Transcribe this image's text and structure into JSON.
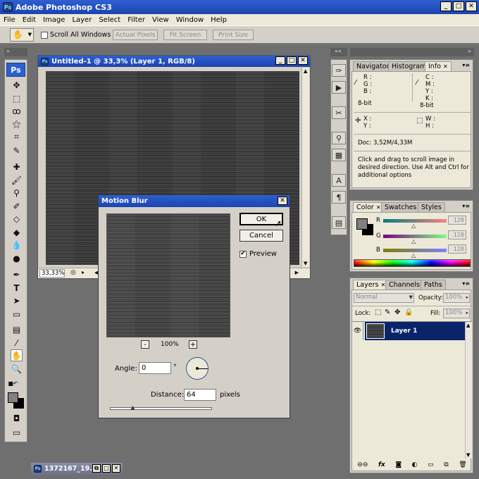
{
  "app": {
    "title": "Adobe Photoshop CS3",
    "icon_text": "Ps"
  },
  "menu": [
    "File",
    "Edit",
    "Image",
    "Layer",
    "Select",
    "Filter",
    "View",
    "Window",
    "Help"
  ],
  "options": {
    "scroll_all_windows_label": "Scroll All Windows",
    "scroll_all_windows_checked": false,
    "actual_pixels": "Actual Pixels",
    "fit_screen": "Fit Screen",
    "print_size": "Print Size"
  },
  "toolbox": {
    "logo": "Ps"
  },
  "document": {
    "title": "Untitled-1 @ 33,3% (Layer 1, RGB/8)",
    "zoom": "33,33%"
  },
  "minimized": {
    "title": "1372167_19..."
  },
  "dialog": {
    "title": "Motion Blur",
    "ok": "OK",
    "cancel": "Cancel",
    "preview_label": "Preview",
    "preview_checked": true,
    "zoom_minus": "-",
    "zoom_plus": "+",
    "zoom_level": "100%",
    "angle_label": "Angle:",
    "angle_value": "0",
    "angle_unit": "°",
    "distance_label": "Distance:",
    "distance_value": "64",
    "distance_unit": "pixels",
    "distance_slider_fraction": 0.23
  },
  "info_panel": {
    "tabs": [
      "Navigator",
      "Histogram",
      "Info"
    ],
    "active_tab": "Info",
    "r": "R :",
    "g": "G :",
    "b": "B :",
    "c": "C :",
    "m": "M :",
    "y": "Y :",
    "k": "K :",
    "bit_left": "8-bit",
    "bit_right": "8-bit",
    "x": "X :",
    "y2": "Y :",
    "w": "W :",
    "h": "H :",
    "doc": "Doc: 3,52M/4,33M",
    "hint": "Click and drag to scroll image in desired direction.  Use Alt and Ctrl for additional options"
  },
  "color_panel": {
    "tabs": [
      "Color",
      "Swatches",
      "Styles"
    ],
    "active_tab": "Color",
    "channels": [
      {
        "label": "R",
        "value": "128"
      },
      {
        "label": "G",
        "value": "128"
      },
      {
        "label": "B",
        "value": "128"
      }
    ]
  },
  "layers_panel": {
    "tabs": [
      "Layers",
      "Channels",
      "Paths"
    ],
    "active_tab": "Layers",
    "blend_mode": "Normal",
    "opacity_label": "Opacity:",
    "opacity": "100%",
    "lock_label": "Lock:",
    "fill_label": "Fill:",
    "fill": "100%",
    "layers": [
      {
        "name": "Layer 1",
        "visible": true,
        "selected": true
      }
    ]
  },
  "colors": {
    "titlebar": "#1b44b1",
    "layer_selected": "#0a246a",
    "canvas": "#3a3a3a",
    "workspace": "#6f6f6f"
  }
}
